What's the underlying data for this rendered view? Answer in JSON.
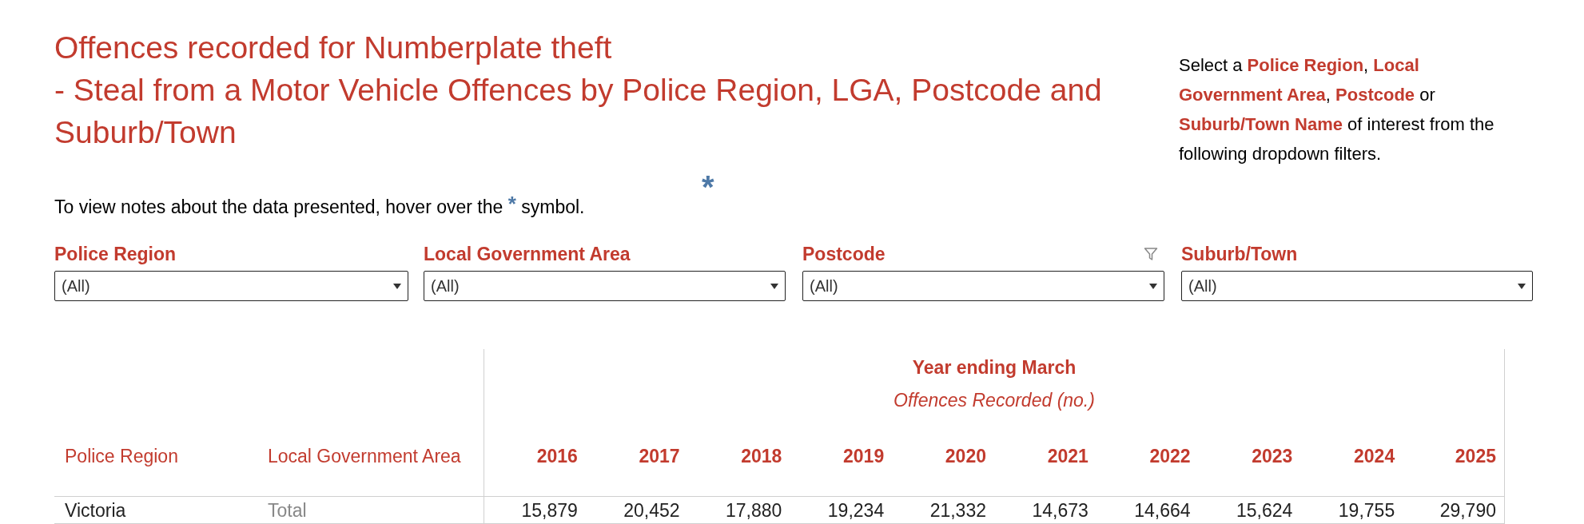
{
  "title_lines": [
    "Offences recorded for Numberplate theft",
    "- Steal from a Motor Vehicle Offences by Police Region, LGA, Postcode and",
    "Suburb/Town"
  ],
  "notes": {
    "before": "To view notes about the data presented, hover over the",
    "marker": "*",
    "after": "symbol."
  },
  "notes_marker": "*",
  "instructions": "Select a **Police Region**, **Local Government Area**, **Postcode** or **Suburb/Town Name** of interest from the following dropdown filters.",
  "filters": [
    {
      "label": "Police Region",
      "value": "(All)",
      "filtered": false
    },
    {
      "label": "Local Government Area",
      "value": "(All)",
      "filtered": false
    },
    {
      "label": "Postcode",
      "value": "(All)",
      "filtered": true
    },
    {
      "label": "Suburb/Town",
      "value": "(All)",
      "filtered": false
    }
  ],
  "table": {
    "group_title": "Year ending March",
    "group_subtitle": "Offences Recorded (no.)",
    "row_headers": [
      "Police Region",
      "Local Government Area"
    ],
    "columns": [
      "2016",
      "2017",
      "2018",
      "2019",
      "2020",
      "2021",
      "2022",
      "2023",
      "2024",
      "2025"
    ],
    "rows": [
      {
        "region": "Victoria",
        "lga": "Total",
        "values": [
          "15,879",
          "20,452",
          "17,880",
          "19,234",
          "21,332",
          "14,673",
          "14,664",
          "15,624",
          "19,755",
          "29,790"
        ]
      }
    ]
  }
}
